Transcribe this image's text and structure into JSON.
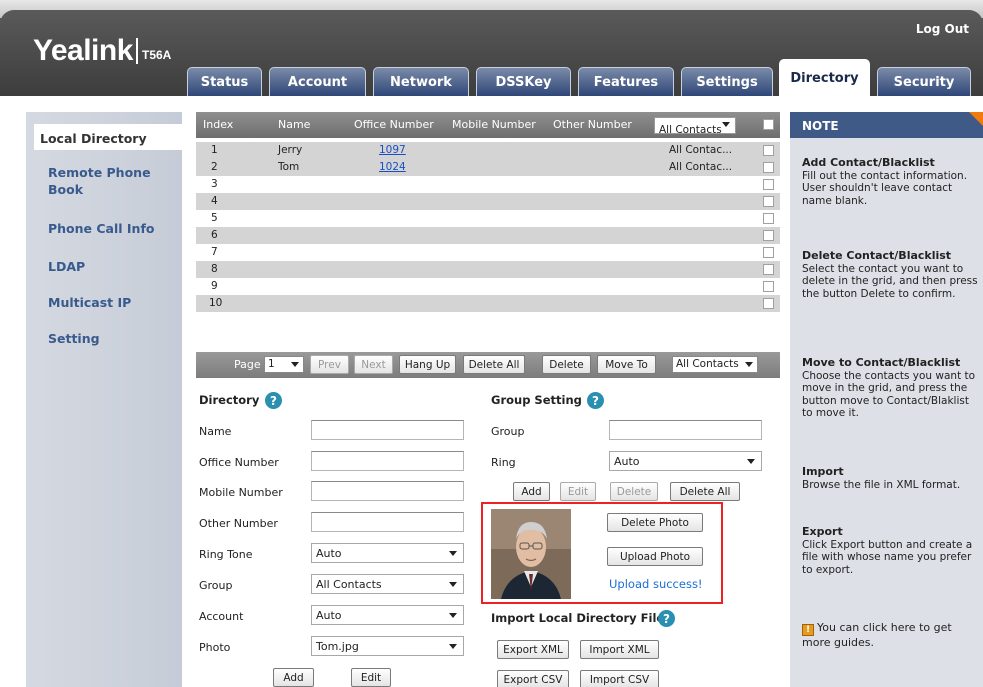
{
  "header": {
    "logo": "Yealink",
    "model": "T56A",
    "logout": "Log Out",
    "tabs": [
      "Status",
      "Account",
      "Network",
      "DSSKey",
      "Features",
      "Settings",
      "Directory",
      "Security"
    ],
    "active_tab": "Directory"
  },
  "sidebar": {
    "items": [
      "Local Directory",
      "Remote Phone Book",
      "Phone Call Info",
      "LDAP",
      "Multicast IP",
      "Setting"
    ],
    "active": "Local Directory"
  },
  "grid": {
    "columns": [
      "Index",
      "Name",
      "Office Number",
      "Mobile Number",
      "Other Number"
    ],
    "filter_value": "All Contacts",
    "rows": [
      {
        "index": "1",
        "name": "Jerry",
        "office": "1097",
        "group": "All Contac..."
      },
      {
        "index": "2",
        "name": "Tom",
        "office": "1024",
        "group": "All Contac..."
      },
      {
        "index": "3",
        "name": "",
        "office": "",
        "group": ""
      },
      {
        "index": "4",
        "name": "",
        "office": "",
        "group": ""
      },
      {
        "index": "5",
        "name": "",
        "office": "",
        "group": ""
      },
      {
        "index": "6",
        "name": "",
        "office": "",
        "group": ""
      },
      {
        "index": "7",
        "name": "",
        "office": "",
        "group": ""
      },
      {
        "index": "8",
        "name": "",
        "office": "",
        "group": ""
      },
      {
        "index": "9",
        "name": "",
        "office": "",
        "group": ""
      },
      {
        "index": "10",
        "name": "",
        "office": "",
        "group": ""
      }
    ]
  },
  "pager": {
    "page_label": "Page",
    "page_value": "1",
    "prev": "Prev",
    "next": "Next",
    "hang_up": "Hang Up",
    "delete_all": "Delete All",
    "delete": "Delete",
    "move_to": "Move To",
    "move_target": "All Contacts"
  },
  "directory_form": {
    "title": "Directory",
    "help": "?",
    "name_label": "Name",
    "office_label": "Office Number",
    "mobile_label": "Mobile Number",
    "other_label": "Other Number",
    "ring_tone_label": "Ring Tone",
    "ring_tone_value": "Auto",
    "group_label": "Group",
    "group_value": "All Contacts",
    "account_label": "Account",
    "account_value": "Auto",
    "photo_label": "Photo",
    "photo_value": "Tom.jpg",
    "add": "Add",
    "edit": "Edit"
  },
  "group_form": {
    "title": "Group Setting",
    "help": "?",
    "group_label": "Group",
    "ring_label": "Ring",
    "ring_value": "Auto",
    "add": "Add",
    "edit": "Edit",
    "delete": "Delete",
    "delete_all": "Delete All"
  },
  "photo_panel": {
    "delete_photo": "Delete Photo",
    "upload_photo": "Upload Photo",
    "status": "Upload success!"
  },
  "import_section": {
    "title": "Import Local Directory File",
    "help": "?",
    "export_xml": "Export XML",
    "import_xml": "Import XML",
    "export_csv": "Export CSV",
    "import_csv": "Import CSV"
  },
  "note": {
    "title": "NOTE",
    "items": [
      {
        "heading": "Add Contact/Blacklist",
        "text": "Fill out the contact information. User shouldn't leave contact name blank."
      },
      {
        "heading": "Delete Contact/Blacklist",
        "text": "Select the contact you want to delete in the grid, and then press the button Delete to confirm."
      },
      {
        "heading": "Move to Contact/Blacklist",
        "text": "Choose the contacts you want to move in the grid, and press the button move to Contact/Blaklist to move it."
      },
      {
        "heading": "Import",
        "text": "Browse the file in XML format."
      },
      {
        "heading": "Export",
        "text": "Click Export button and create a file with whose name you prefer to export."
      }
    ],
    "guide_text": "You can click here to get more guides."
  },
  "colors": {
    "tab_blue": "#2f4778",
    "sidebar_link": "#395a8c",
    "note_header": "#3f5a86",
    "highlight_border": "#ee2222",
    "link": "#1a4fc4"
  }
}
